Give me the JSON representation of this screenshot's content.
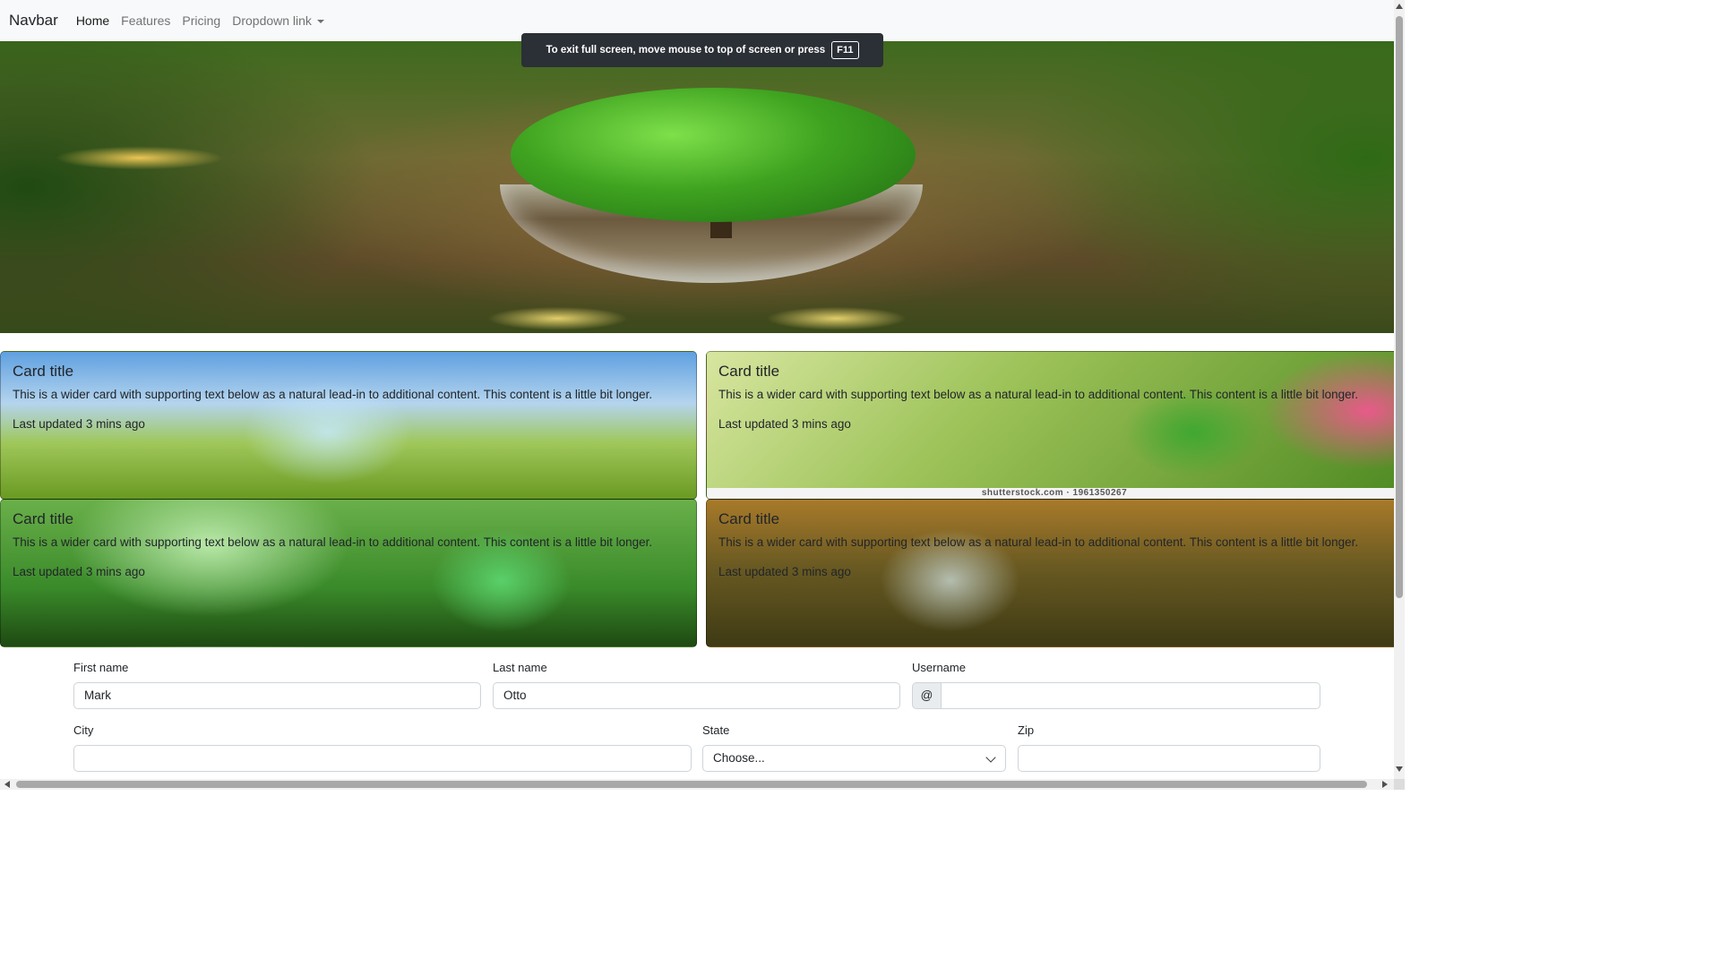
{
  "navbar": {
    "brand": "Navbar",
    "links": [
      "Home",
      "Features",
      "Pricing",
      "Dropdown link"
    ]
  },
  "fullscreen_notice": {
    "text": "To exit full screen, move mouse to top of screen or press",
    "key": "F11"
  },
  "cards": [
    {
      "title": "Card title",
      "text": "This is a wider card with supporting text below as a natural lead-in to additional content. This content is a little bit longer.",
      "updated": "Last updated 3 mins ago"
    },
    {
      "title": "Card title",
      "text": "This is a wider card with supporting text below as a natural lead-in to additional content. This content is a little bit longer.",
      "updated": "Last updated 3 mins ago",
      "watermark": "shutterstock.com · 1961350267"
    },
    {
      "title": "Card title",
      "text": "This is a wider card with supporting text below as a natural lead-in to additional content. This content is a little bit longer.",
      "updated": "Last updated 3 mins ago"
    },
    {
      "title": "Card title",
      "text": "This is a wider card with supporting text below as a natural lead-in to additional content. This content is a little bit longer.",
      "updated": "Last updated 3 mins ago"
    }
  ],
  "form": {
    "first_name": {
      "label": "First name",
      "value": "Mark"
    },
    "last_name": {
      "label": "Last name",
      "value": "Otto"
    },
    "username": {
      "label": "Username",
      "prefix": "@",
      "value": ""
    },
    "city": {
      "label": "City",
      "value": ""
    },
    "state": {
      "label": "State",
      "selected": "Choose..."
    },
    "zip": {
      "label": "Zip",
      "value": ""
    }
  },
  "icons": {
    "dropdown_caret": "caret-down-icon",
    "select_chevron": "chevron-down-icon"
  }
}
